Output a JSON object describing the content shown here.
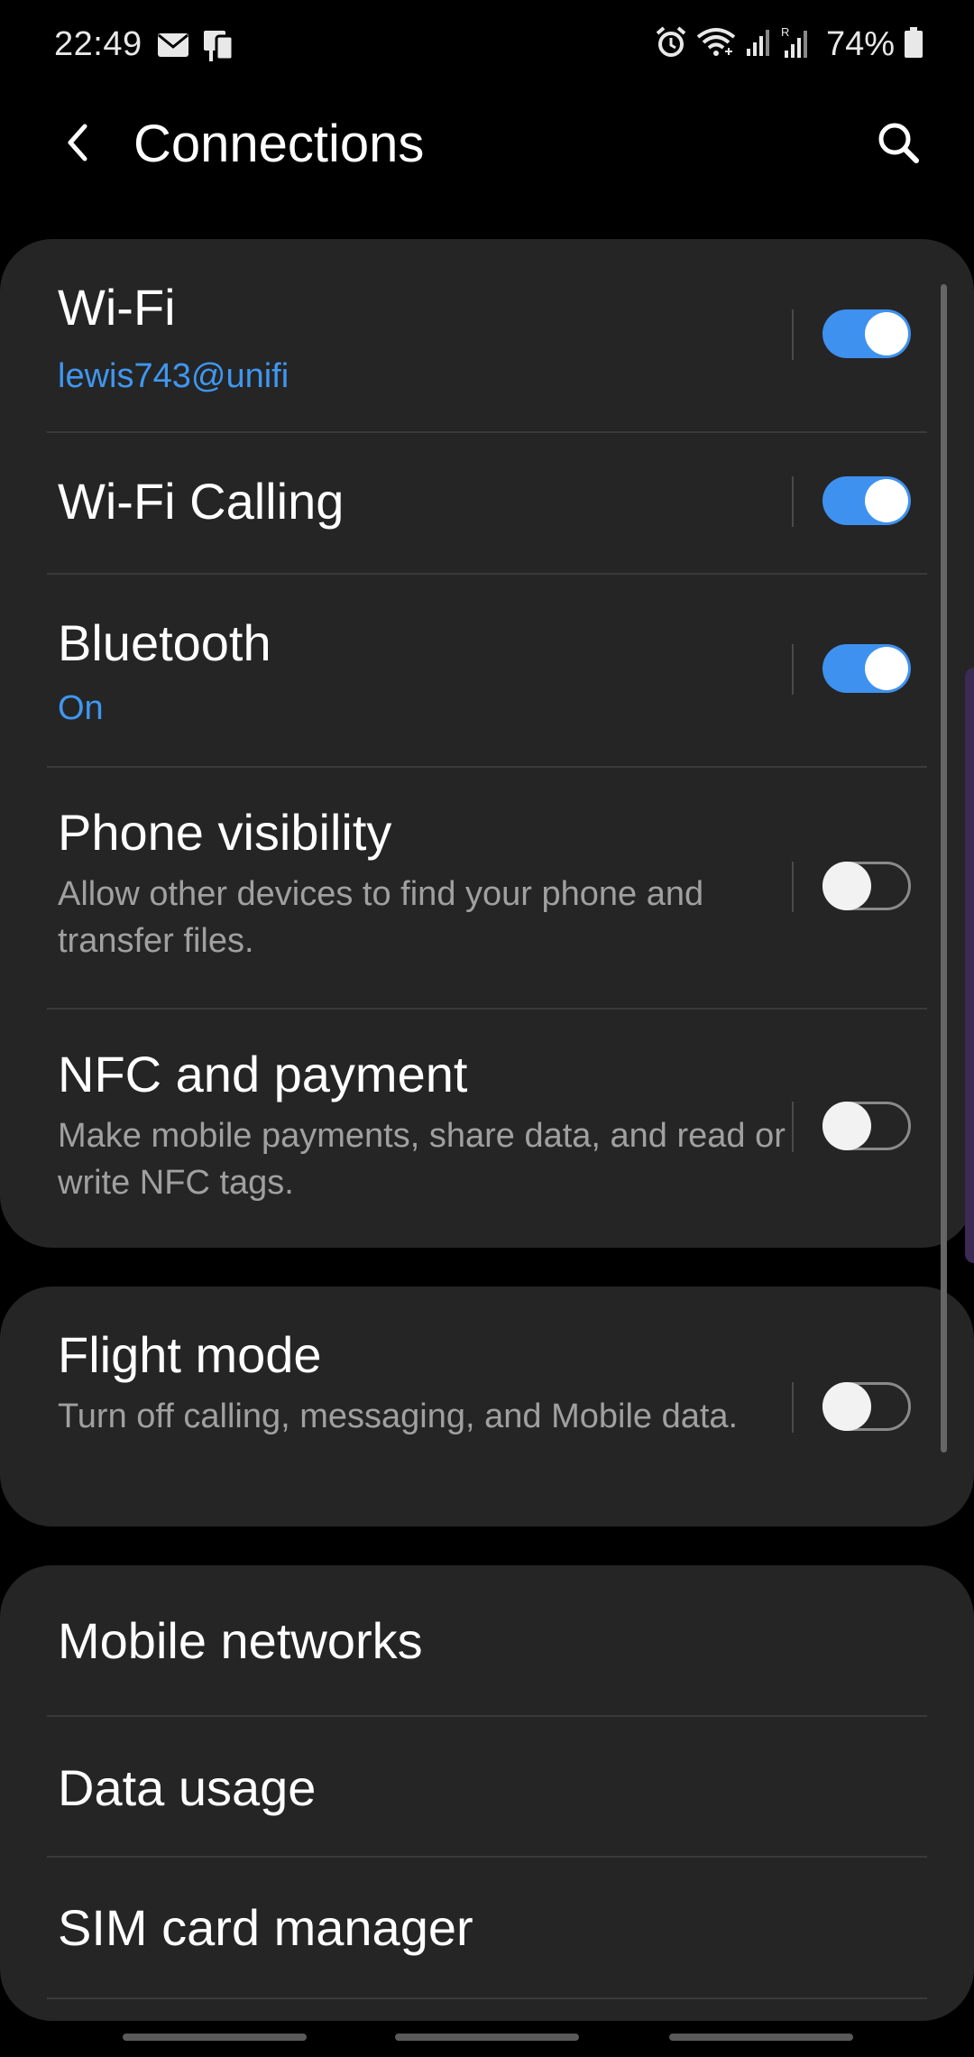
{
  "status_bar": {
    "time": "22:49",
    "battery_percent": "74%",
    "icons": [
      "mail-icon",
      "device-icon",
      "alarm-icon",
      "wifi-calling-icon",
      "signal-icon",
      "roaming-signal-icon",
      "battery-icon"
    ]
  },
  "app_bar": {
    "title": "Connections",
    "back_icon": "back-arrow-icon",
    "search_icon": "search-icon"
  },
  "group1": [
    {
      "label": "Wi-Fi",
      "sub": "lewis743@unifi",
      "toggle_on": true
    },
    {
      "label": "Wi-Fi Calling",
      "toggle_on": true
    },
    {
      "label": "Bluetooth",
      "sub": "On",
      "toggle_on": true
    },
    {
      "label": "Phone visibility",
      "sub": "Allow other devices to find your phone and transfer files.",
      "toggle_on": false
    },
    {
      "label": "NFC and payment",
      "sub": "Make mobile payments, share data, and read or write NFC tags.",
      "toggle_on": false
    }
  ],
  "group2": [
    {
      "label": "Flight mode",
      "sub": "Turn off calling, messaging, and Mobile data.",
      "toggle_on": false
    }
  ],
  "group3": [
    {
      "label": "Mobile networks"
    },
    {
      "label": "Data usage"
    },
    {
      "label": "SIM card manager"
    }
  ],
  "colors": {
    "accent": "#3e91ef",
    "card_bg": "#252525",
    "background": "#000000",
    "secondary_text": "#a0a0a0"
  }
}
